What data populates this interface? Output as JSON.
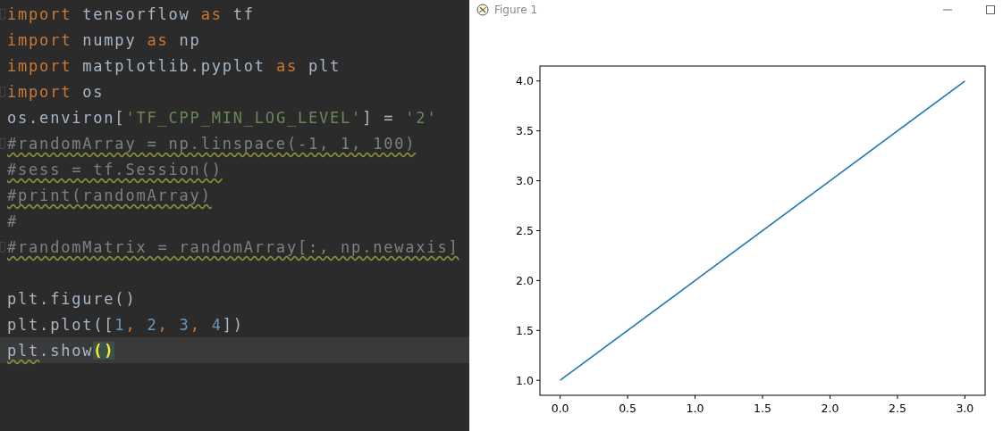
{
  "editor": {
    "lines": [
      {
        "fold": true,
        "warning": false,
        "current": false,
        "tokens": [
          {
            "kind": "keyword",
            "text": "import"
          },
          {
            "kind": "plain",
            "text": " tensorflow "
          },
          {
            "kind": "keyword",
            "text": "as"
          },
          {
            "kind": "plain",
            "text": " tf"
          }
        ]
      },
      {
        "fold": false,
        "warning": false,
        "current": false,
        "tokens": [
          {
            "kind": "keyword",
            "text": "import"
          },
          {
            "kind": "plain",
            "text": " numpy "
          },
          {
            "kind": "keyword",
            "text": "as"
          },
          {
            "kind": "plain",
            "text": " np"
          }
        ]
      },
      {
        "fold": false,
        "warning": false,
        "current": false,
        "tokens": [
          {
            "kind": "keyword",
            "text": "import"
          },
          {
            "kind": "plain",
            "text": " matplotlib.pyplot "
          },
          {
            "kind": "keyword",
            "text": "as"
          },
          {
            "kind": "plain",
            "text": " plt"
          }
        ]
      },
      {
        "fold": true,
        "warning": false,
        "current": false,
        "tokens": [
          {
            "kind": "keyword",
            "text": "import"
          },
          {
            "kind": "plain",
            "text": " os"
          }
        ]
      },
      {
        "fold": false,
        "warning": false,
        "current": false,
        "tokens": [
          {
            "kind": "plain",
            "text": "os.environ["
          },
          {
            "kind": "string",
            "text": "'TF_CPP_MIN_LOG_LEVEL'"
          },
          {
            "kind": "plain",
            "text": "] = "
          },
          {
            "kind": "string",
            "text": "'2'"
          }
        ]
      },
      {
        "fold": true,
        "warning": true,
        "current": false,
        "tokens": [
          {
            "kind": "comment",
            "text": "#randomArray = np.linspace(-1, 1, 100)"
          }
        ]
      },
      {
        "fold": false,
        "warning": true,
        "current": false,
        "tokens": [
          {
            "kind": "comment",
            "text": "#sess = tf.Session()"
          }
        ]
      },
      {
        "fold": false,
        "warning": true,
        "current": false,
        "tokens": [
          {
            "kind": "comment",
            "text": "#print(randomArray)"
          }
        ]
      },
      {
        "fold": false,
        "warning": false,
        "current": false,
        "tokens": [
          {
            "kind": "comment",
            "text": "#"
          }
        ]
      },
      {
        "fold": true,
        "warning": true,
        "current": false,
        "tokens": [
          {
            "kind": "comment",
            "text": "#randomMatrix = randomArray[:, np.newaxis]"
          }
        ]
      },
      {
        "kind": "blank"
      },
      {
        "fold": false,
        "warning": false,
        "current": false,
        "tokens": [
          {
            "kind": "plain",
            "text": "plt.figure()"
          }
        ]
      },
      {
        "fold": false,
        "warning": false,
        "current": false,
        "tokens": [
          {
            "kind": "plain",
            "text": "plt.plot(["
          },
          {
            "kind": "number",
            "text": "1"
          },
          {
            "kind": "keyword",
            "text": ", "
          },
          {
            "kind": "number",
            "text": "2"
          },
          {
            "kind": "keyword",
            "text": ", "
          },
          {
            "kind": "number",
            "text": "3"
          },
          {
            "kind": "keyword",
            "text": ", "
          },
          {
            "kind": "number",
            "text": "4"
          },
          {
            "kind": "plain",
            "text": "])"
          }
        ]
      },
      {
        "fold": false,
        "warning": false,
        "current": true,
        "tokens": [
          {
            "kind": "warned",
            "text": "plt"
          },
          {
            "kind": "plain",
            "text": ".show"
          },
          {
            "kind": "brace",
            "text": "()"
          }
        ]
      }
    ]
  },
  "figure_window": {
    "title": "Figure 1",
    "chart_data": {
      "type": "line",
      "x": [
        0,
        1,
        2,
        3
      ],
      "series": [
        {
          "color": "#1f77b4",
          "values": [
            1,
            2,
            3,
            4
          ]
        }
      ],
      "xlim": [
        -0.15,
        3.15
      ],
      "ylim": [
        0.85,
        4.15
      ],
      "xticks": [
        {
          "value": 0,
          "label": "0.0"
        },
        {
          "value": 0.5,
          "label": "0.5"
        },
        {
          "value": 1,
          "label": "1.0"
        },
        {
          "value": 1.5,
          "label": "1.5"
        },
        {
          "value": 2,
          "label": "2.0"
        },
        {
          "value": 2.5,
          "label": "2.5"
        },
        {
          "value": 3,
          "label": "3.0"
        }
      ],
      "yticks": [
        {
          "value": 1,
          "label": "1.0"
        },
        {
          "value": 1.5,
          "label": "1.5"
        },
        {
          "value": 2,
          "label": "2.0"
        },
        {
          "value": 2.5,
          "label": "2.5"
        },
        {
          "value": 3,
          "label": "3.0"
        },
        {
          "value": 3.5,
          "label": "3.5"
        },
        {
          "value": 4,
          "label": "4.0"
        }
      ]
    }
  }
}
